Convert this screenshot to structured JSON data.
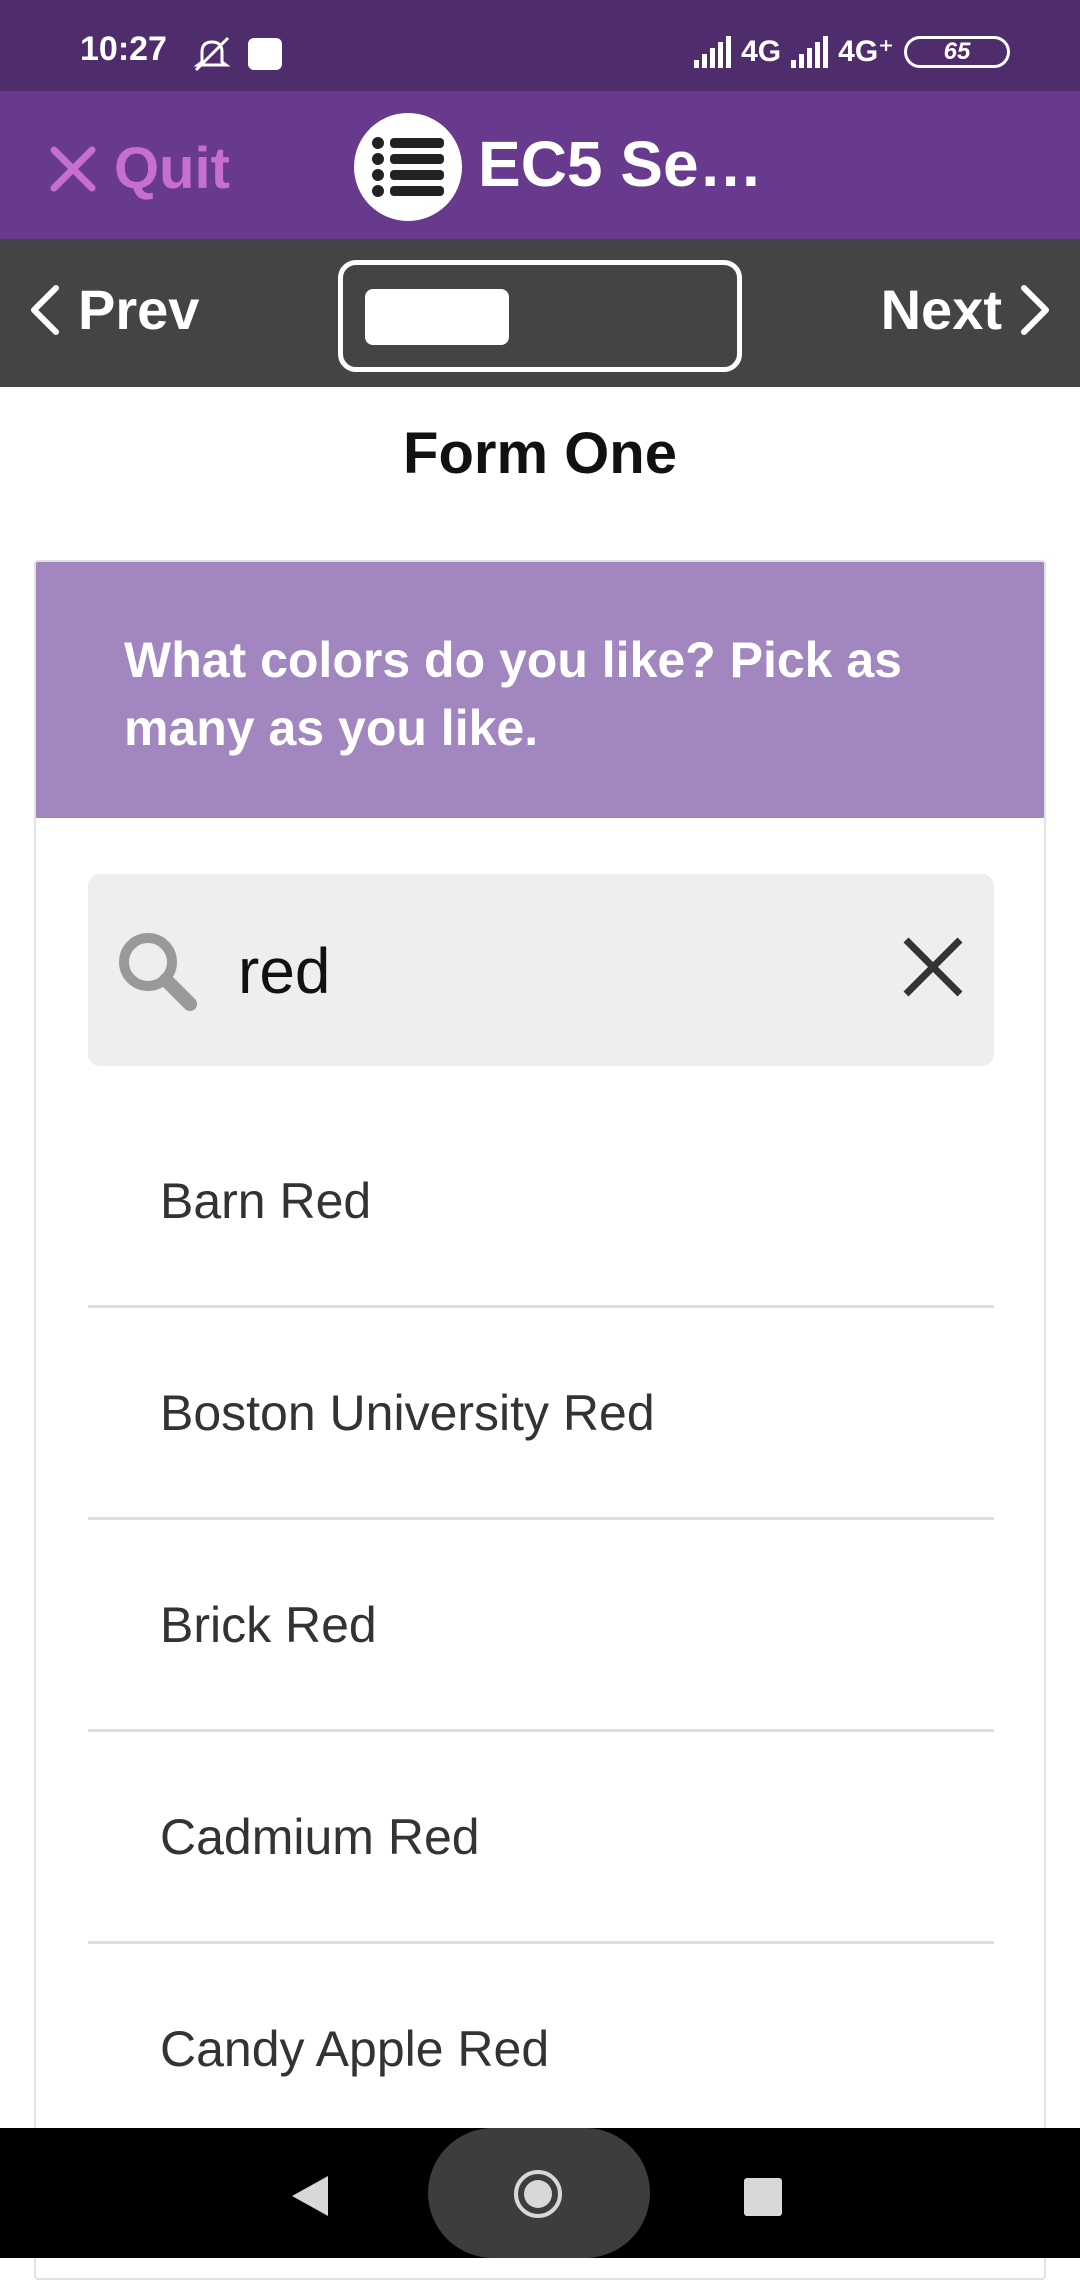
{
  "status_bar": {
    "time": "10:27",
    "network_1": "4G",
    "network_2": "4G⁺",
    "battery": "65",
    "icons": [
      "mute-icon",
      "notification-square-icon",
      "signal-icon",
      "battery-icon"
    ]
  },
  "app_bar": {
    "quit_label": "Quit",
    "title": "EC5 Se…",
    "brand_color": "#673a8e",
    "quit_color": "#c76fd0"
  },
  "nav": {
    "prev_label": "Prev",
    "next_label": "Next",
    "progress": 0.41
  },
  "form": {
    "title": "Form One",
    "question": "What colors do you like? Pick as many as you like.",
    "question_bg": "#a286c0",
    "search": {
      "value": "red",
      "placeholder": ""
    },
    "options": [
      "Barn Red",
      "Boston University Red",
      "Brick Red",
      "Cadmium Red",
      "Candy Apple Red"
    ]
  }
}
